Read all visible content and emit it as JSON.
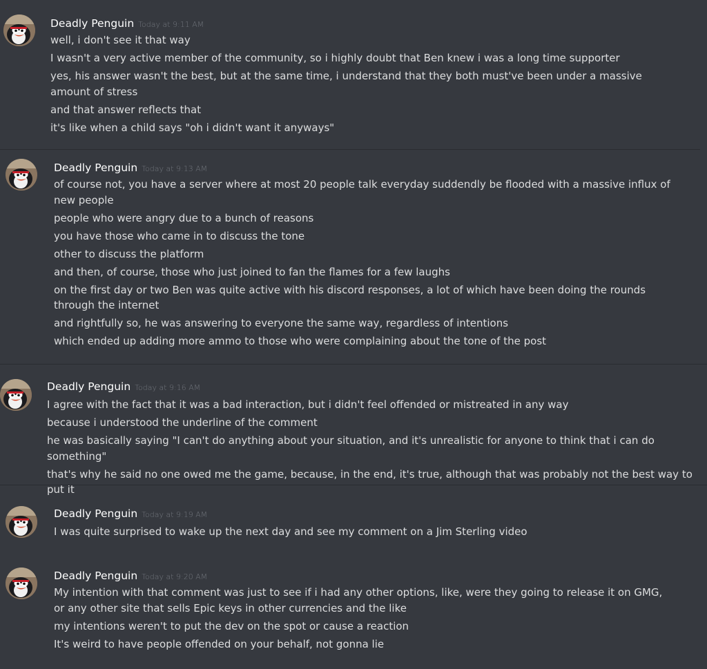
{
  "colors": {
    "background": "#36393f",
    "username": "#ffffff",
    "timestamp": "#72767d",
    "message_text": "#dcddde",
    "separator": "#2a2c31"
  },
  "messages": [
    {
      "avatar_icon": "penguin-avatar-icon",
      "username": "Deadly Penguin",
      "timestamp": "Today at 9:11 AM",
      "lines": [
        "well, i don't see it that way",
        "I wasn't a very active member of the community, so i highly doubt that Ben knew i was a long time supporter",
        "yes, his answer wasn't the best, but at the same time, i understand that they both must've been under a massive amount of stress",
        "and that answer reflects that",
        "it's like when a child says \"oh i didn't want it anyways\""
      ]
    },
    {
      "avatar_icon": "penguin-avatar-icon",
      "username": "Deadly Penguin",
      "timestamp": "Today at 9:13 AM",
      "lines": [
        "of course not, you have a server where at most 20 people talk everyday suddendly be flooded with a massive influx of new people",
        "people who were angry due to a bunch of reasons",
        "you have those who came in to discuss the tone",
        "other to discuss the platform",
        "and then, of course, those who just joined to fan the flames for a few laughs",
        "on the first day or two Ben was quite active with his discord responses, a lot of which have been doing the rounds through the internet",
        "and rightfully so, he was answering to everyone the same way, regardless of intentions",
        "which ended up adding more ammo to those who were complaining about the tone of the post"
      ]
    },
    {
      "avatar_icon": "penguin-avatar-icon",
      "username": "Deadly Penguin",
      "timestamp": "Today at 9:16 AM",
      "lines": [
        "I agree with the fact that it was a bad interaction, but i didn't feel offended or mistreated in any way",
        "because i understood the underline of the comment",
        "he was basically saying \"I can't do anything about your situation, and it's unrealistic for anyone to think that i can do something\"",
        "that's why he said no one owed me the game, because, in the end, it's true, although that was probably not the best way to put it"
      ]
    },
    {
      "avatar_icon": "penguin-avatar-icon",
      "username": "Deadly Penguin",
      "timestamp": "Today at 9:19 AM",
      "lines": [
        "I was quite surprised to wake up the next day and see my comment on a Jim Sterling video"
      ]
    },
    {
      "avatar_icon": "penguin-avatar-icon",
      "username": "Deadly Penguin",
      "timestamp": "Today at 9:20 AM",
      "lines": [
        "My intention with that comment was just to see if i had any other options, like, were they going to release it on GMG, or any other site that sells Epic keys in other currencies and the like",
        "my intentions weren't to put the dev on the spot or cause a reaction",
        "It's weird to have people offended on your behalf, not gonna lie"
      ]
    }
  ]
}
